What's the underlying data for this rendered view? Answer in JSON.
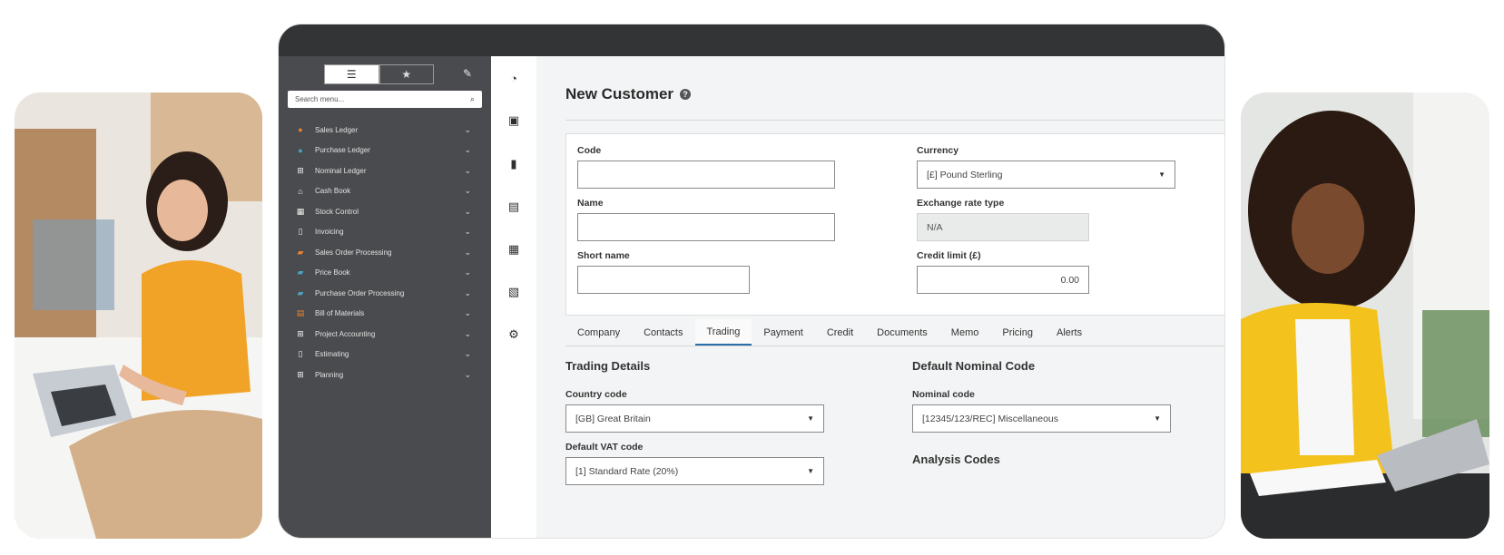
{
  "sidebar": {
    "view_toggle": {
      "menu_icon": "list-icon",
      "favourites_icon": "star-icon"
    },
    "search": {
      "placeholder": "Search menu..."
    },
    "items": [
      {
        "label": "Sales Ledger",
        "icon": "person-icon",
        "color": "#e9822f"
      },
      {
        "label": "Purchase Ledger",
        "icon": "person-icon",
        "color": "#4aa3c7"
      },
      {
        "label": "Nominal Ledger",
        "icon": "square-plus-icon",
        "color": "#f0f0f0"
      },
      {
        "label": "Cash Book",
        "icon": "bank-icon",
        "color": "#f0f0f0"
      },
      {
        "label": "Stock Control",
        "icon": "boxes-icon",
        "color": "#f0f0f0"
      },
      {
        "label": "Invoicing",
        "icon": "document-icon",
        "color": "#f0f0f0"
      },
      {
        "label": "Sales Order Processing",
        "icon": "order-icon",
        "color": "#e9822f"
      },
      {
        "label": "Price Book",
        "icon": "book-icon",
        "color": "#4aa3c7"
      },
      {
        "label": "Purchase Order Processing",
        "icon": "order-icon",
        "color": "#4aa3c7"
      },
      {
        "label": "Bill of Materials",
        "icon": "list-doc-icon",
        "color": "#e9822f"
      },
      {
        "label": "Project Accounting",
        "icon": "square-plus-icon",
        "color": "#f0f0f0"
      },
      {
        "label": "Estimating",
        "icon": "document-icon",
        "color": "#f0f0f0"
      },
      {
        "label": "Planning",
        "icon": "square-plus-icon",
        "color": "#f0f0f0"
      }
    ]
  },
  "rail": [
    "dashboard-icon",
    "book-icon",
    "calculator-icon",
    "id-card-icon",
    "boxes-icon",
    "report-icon",
    "settings-icon"
  ],
  "page": {
    "title": "New Customer",
    "help_icon": "question-icon"
  },
  "form": {
    "code": {
      "label": "Code",
      "value": ""
    },
    "name": {
      "label": "Name",
      "value": ""
    },
    "short_name": {
      "label": "Short name",
      "value": ""
    },
    "currency": {
      "label": "Currency",
      "value": "[£] Pound Sterling"
    },
    "exchange_rate_type": {
      "label": "Exchange rate type",
      "value": "N/A"
    },
    "credit_limit": {
      "label": "Credit limit (£)",
      "value": "0.00"
    }
  },
  "tabs": [
    "Company",
    "Contacts",
    "Trading",
    "Payment",
    "Credit",
    "Documents",
    "Memo",
    "Pricing",
    "Alerts"
  ],
  "active_tab": "Trading",
  "trading": {
    "title": "Trading Details",
    "country_code": {
      "label": "Country code",
      "value": "[GB] Great Britain"
    },
    "default_vat_code": {
      "label": "Default VAT code",
      "value": "[1] Standard Rate (20%)"
    }
  },
  "nominal": {
    "title": "Default Nominal Code",
    "nominal_code": {
      "label": "Nominal code",
      "value": "[12345/123/REC] Miscellaneous"
    }
  },
  "analysis": {
    "title": "Analysis Codes"
  },
  "colors": {
    "sidebar_bg": "#4a4b4e",
    "frame_top": "#333436",
    "accent": "#2a6fa8",
    "content_bg": "#f3f4f5"
  }
}
